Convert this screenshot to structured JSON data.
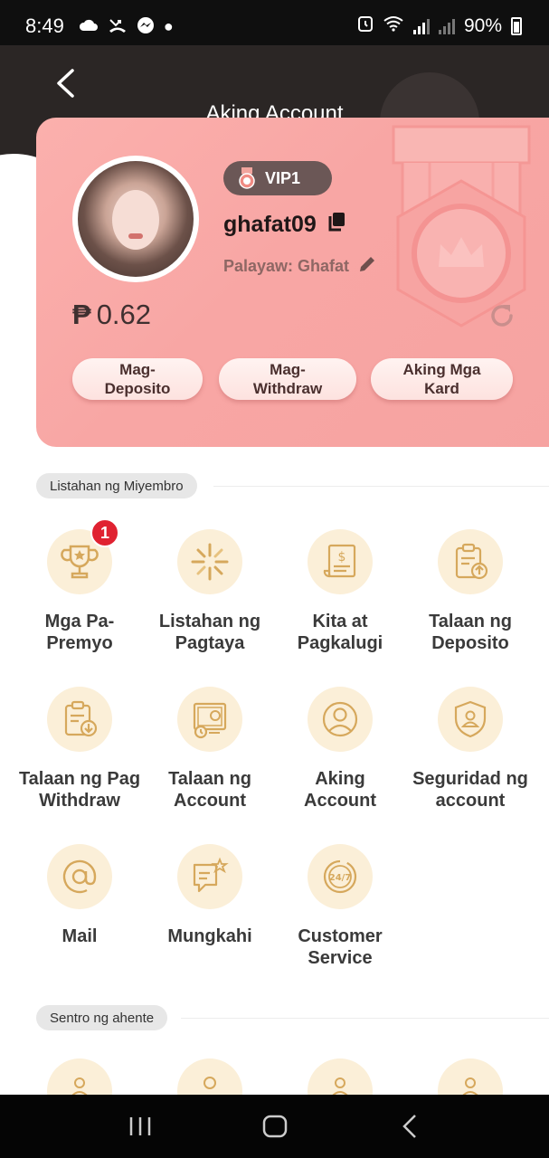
{
  "status_bar": {
    "time": "8:49",
    "battery": "90%",
    "icons": [
      "cloud-icon",
      "missed-call-icon",
      "messenger-icon",
      "dot-icon",
      "alarm-icon",
      "wifi-icon",
      "signal-icon",
      "battery-icon"
    ]
  },
  "header": {
    "title": "Aking Account",
    "back_icon": "chevron-left-icon"
  },
  "profile": {
    "vip_level": "VIP1",
    "username": "ghafat09",
    "nickname_label": "Palayaw: Ghafat",
    "currency_symbol": "₱",
    "balance": "0.62",
    "actions": [
      {
        "label": "Mag-\nDeposito"
      },
      {
        "label": "Mag-\nWithdraw"
      },
      {
        "label": "Aking Mga\nKard"
      }
    ]
  },
  "member_section": {
    "label": "Listahan ng Miyembro",
    "items": [
      {
        "label": "Mga Pa-\nPremyo",
        "icon": "trophy-icon",
        "badge": "1"
      },
      {
        "label": "Listahan ng\nPagtaya",
        "icon": "sparkle-icon"
      },
      {
        "label": "Kita at\nPagkalugi",
        "icon": "receipt-icon"
      },
      {
        "label": "Talaan ng\nDeposito",
        "icon": "clipboard-upload-icon"
      },
      {
        "label": "Talaan ng Pag\nWithdraw",
        "icon": "clipboard-download-icon"
      },
      {
        "label": "Talaan ng\nAccount",
        "icon": "certificate-icon"
      },
      {
        "label": "Aking\nAccount",
        "icon": "user-icon"
      },
      {
        "label": "Seguridad ng\naccount",
        "icon": "shield-user-icon"
      },
      {
        "label": "Mail",
        "icon": "at-icon"
      },
      {
        "label": "Mungkahi",
        "icon": "feedback-icon"
      },
      {
        "label": "Customer\nService",
        "icon": "support-24-7-icon"
      }
    ]
  },
  "agent_section": {
    "label": "Sentro ng ahente"
  },
  "colors": {
    "card_bg": "#f8a6a4",
    "icon_bg": "#fbefd8",
    "icon_stroke": "#d6a85c",
    "badge": "#e02231",
    "vip_badge": "#6b5756"
  }
}
